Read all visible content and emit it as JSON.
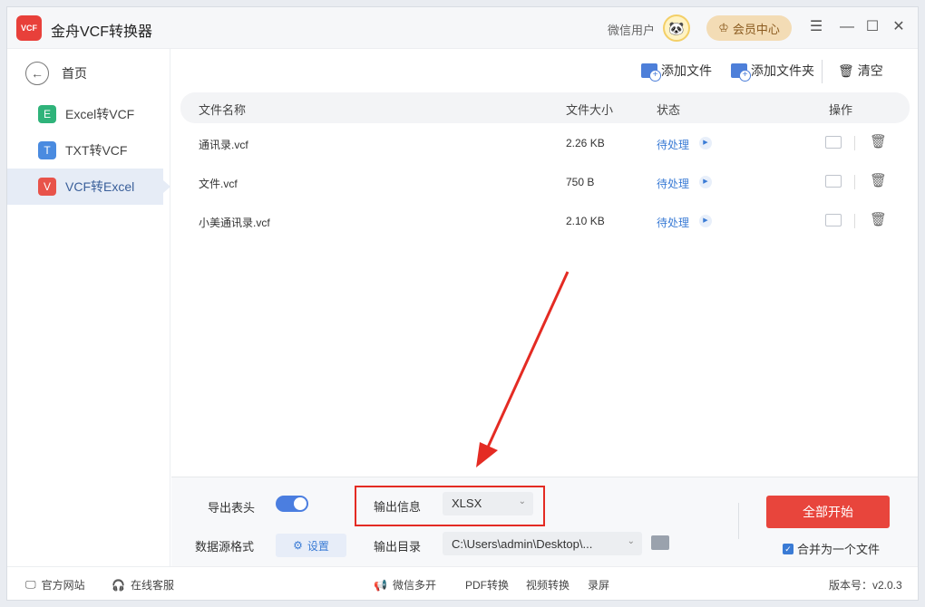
{
  "app": {
    "title": "金舟VCF转换器",
    "logo_text": "VCF"
  },
  "user": {
    "label": "微信用户",
    "vip_label": "会员中心"
  },
  "window_controls": {
    "menu": "☰",
    "minimize": "—",
    "maximize": "☐",
    "close": "✕"
  },
  "sidebar": {
    "home_label": "首页",
    "items": [
      {
        "badge": "E",
        "label": "Excel转VCF",
        "color": "#2fb37a"
      },
      {
        "badge": "T",
        "label": "TXT转VCF",
        "color": "#4a8be0"
      },
      {
        "badge": "V",
        "label": "VCF转Excel",
        "color": "#e8534a"
      }
    ]
  },
  "toolbar": {
    "add_file": "添加文件",
    "add_folder": "添加文件夹",
    "clear": "清空"
  },
  "table": {
    "headers": {
      "name": "文件名称",
      "size": "文件大小",
      "status": "状态",
      "actions": "操作"
    },
    "rows": [
      {
        "name": "通讯录.vcf",
        "size": "2.26 KB",
        "status": "待处理"
      },
      {
        "name": "文件.vcf",
        "size": "750 B",
        "status": "待处理"
      },
      {
        "name": "小美通讯录.vcf",
        "size": "2.10 KB",
        "status": "待处理"
      }
    ]
  },
  "options": {
    "export_header_label": "导出表头",
    "data_format_label": "数据源格式",
    "settings_label": "设置",
    "output_info_label": "输出信息",
    "output_format": "XLSX",
    "output_dir_label": "输出目录",
    "output_dir": "C:\\Users\\admin\\Desktop\\...",
    "start_label": "全部开始",
    "merge_label": "合并为一个文件"
  },
  "statusbar": {
    "website": "官方网站",
    "support": "在线客服",
    "wechat_multi": "微信多开",
    "pdf": "PDF转换",
    "video": "视频转换",
    "record": "录屏",
    "version": "版本号：v2.0.3"
  },
  "colors": {
    "accent": "#3a7bd5",
    "primary_action": "#e8453c",
    "highlight_box": "#e42b23"
  }
}
